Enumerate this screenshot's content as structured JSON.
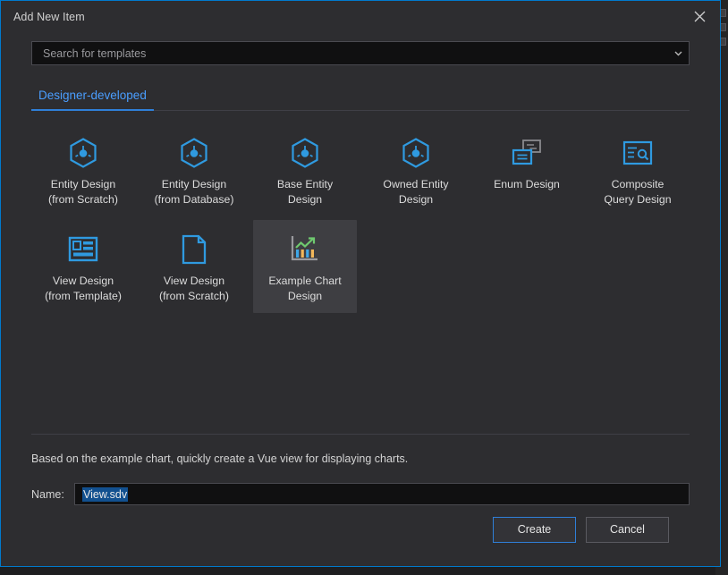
{
  "window": {
    "title": "Add New Item",
    "close_icon": "close-icon"
  },
  "search": {
    "placeholder": "Search for templates",
    "value": "",
    "chevron_icon": "chevron-down-icon"
  },
  "tabs": [
    {
      "label": "Designer-developed",
      "active": true
    }
  ],
  "colors": {
    "accent": "#007acc",
    "tab_text": "#4a9eff",
    "icon_blue": "#2f9ae0",
    "icon_green": "#6fc96f",
    "icon_orange": "#f2b75a",
    "selection": "#12508f",
    "dialog_bg": "#2d2d30",
    "tile_selected_bg": "#3e3e42"
  },
  "templates": [
    {
      "label": "Entity Design\n(from Scratch)",
      "icon": "entity-hexagon-icon",
      "selected": false
    },
    {
      "label": "Entity Design\n(from Database)",
      "icon": "entity-hexagon-icon",
      "selected": false
    },
    {
      "label": "Base Entity\nDesign",
      "icon": "entity-hexagon-icon",
      "selected": false
    },
    {
      "label": "Owned Entity\nDesign",
      "icon": "entity-hexagon-icon",
      "selected": false
    },
    {
      "label": "Enum Design",
      "icon": "enum-windows-icon",
      "selected": false
    },
    {
      "label": "Composite\nQuery Design",
      "icon": "query-search-icon",
      "selected": false
    },
    {
      "label": "View Design\n(from Template)",
      "icon": "view-template-icon",
      "selected": false
    },
    {
      "label": "View Design\n(from Scratch)",
      "icon": "blank-page-icon",
      "selected": false
    },
    {
      "label": "Example Chart\nDesign",
      "icon": "chart-icon",
      "selected": true
    }
  ],
  "details": {
    "description": "Based on the example chart, quickly create a Vue view for displaying charts.",
    "name_label": "Name:",
    "name_value": "View.sdv"
  },
  "footer": {
    "create_label": "Create",
    "cancel_label": "Cancel"
  }
}
